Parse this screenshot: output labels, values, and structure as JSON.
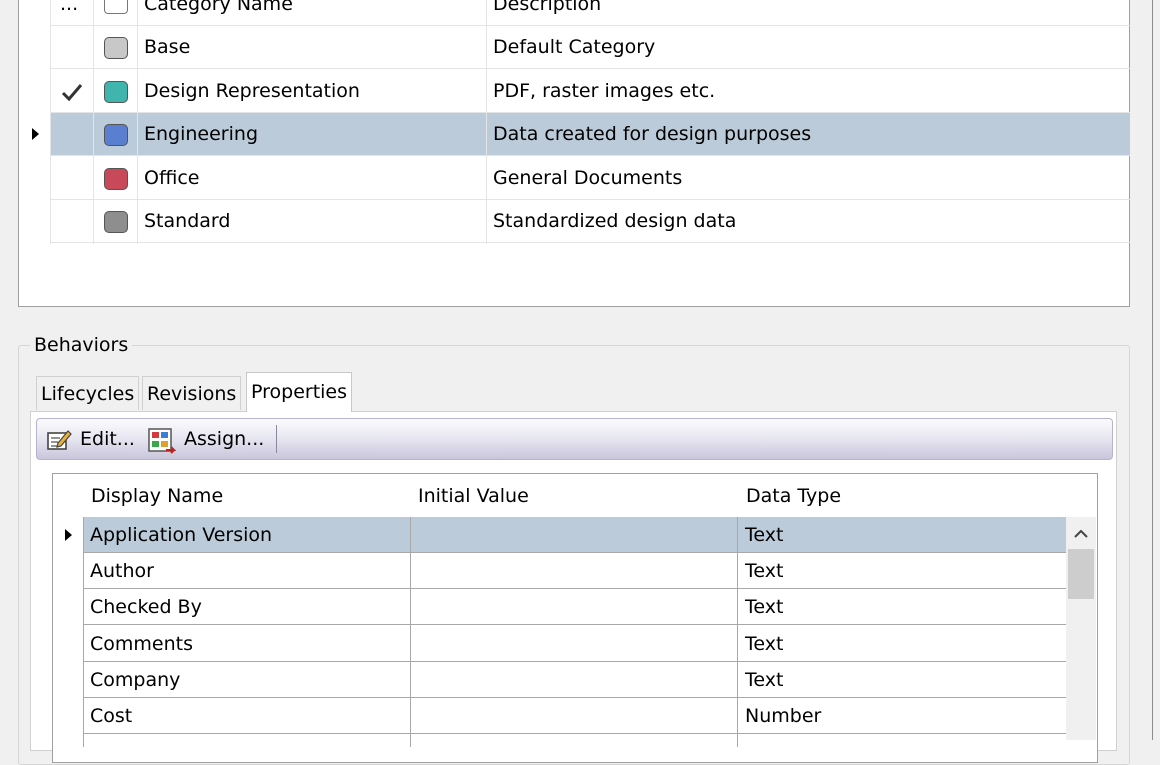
{
  "categories": {
    "headers": {
      "marker": "...",
      "name": "Category Name",
      "description": "Description"
    },
    "rows": [
      {
        "name": "Base",
        "description": "Default Category",
        "color": "#c8c8c8",
        "checked": false,
        "selected": false
      },
      {
        "name": "Design Representation",
        "description": "PDF, raster images etc.",
        "color": "#3fb5ad",
        "checked": true,
        "selected": false
      },
      {
        "name": "Engineering",
        "description": "Data created for design purposes",
        "color": "#5a7fd0",
        "checked": false,
        "selected": true
      },
      {
        "name": "Office",
        "description": "General Documents",
        "color": "#c84a5a",
        "checked": false,
        "selected": false
      },
      {
        "name": "Standard",
        "description": "Standardized design data",
        "color": "#8e8e8e",
        "checked": false,
        "selected": false
      }
    ]
  },
  "behaviors": {
    "title": "Behaviors",
    "tabs": [
      {
        "label": "Lifecycles",
        "active": false
      },
      {
        "label": "Revisions",
        "active": false
      },
      {
        "label": "Properties",
        "active": true
      }
    ],
    "toolbar": {
      "edit_label": "Edit...",
      "assign_label": "Assign..."
    },
    "properties": {
      "headers": {
        "display_name": "Display Name",
        "initial_value": "Initial Value",
        "data_type": "Data Type"
      },
      "rows": [
        {
          "display_name": "Application Version",
          "initial_value": "",
          "data_type": "Text",
          "selected": true
        },
        {
          "display_name": "Author",
          "initial_value": "",
          "data_type": "Text",
          "selected": false
        },
        {
          "display_name": "Checked By",
          "initial_value": "",
          "data_type": "Text",
          "selected": false
        },
        {
          "display_name": "Comments",
          "initial_value": "",
          "data_type": "Text",
          "selected": false
        },
        {
          "display_name": "Company",
          "initial_value": "",
          "data_type": "Text",
          "selected": false
        },
        {
          "display_name": "Cost",
          "initial_value": "",
          "data_type": "Number",
          "selected": false
        }
      ]
    }
  },
  "icons": {
    "row_marker": "row-pointer-icon",
    "checkmark": "checkmark-icon",
    "edit": "edit-icon",
    "assign": "assign-icon",
    "scroll_up": "chevron-up-icon"
  }
}
